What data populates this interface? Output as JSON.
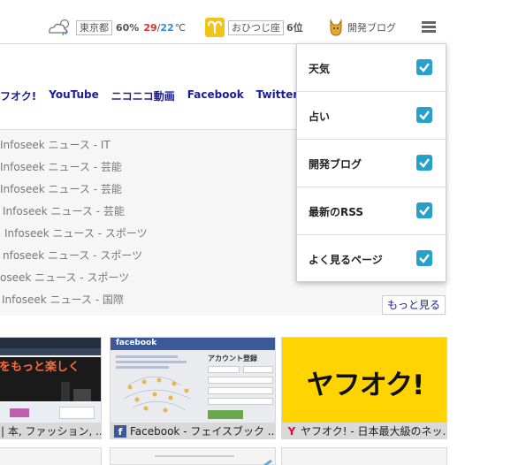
{
  "topbar": {
    "weather": {
      "city": "東京都",
      "humidity": "60%",
      "high": "29",
      "separator": "/",
      "low": "22",
      "unit": "℃",
      "icon": "cloud-rain-icon"
    },
    "fortune": {
      "sign": "おひつじ座",
      "rank": "6位",
      "icon": "aries-icon"
    },
    "blog": {
      "label": "開発ブログ",
      "icon": "mascot-icon"
    },
    "menu_icon": "menu-icon"
  },
  "links": [
    "ヤフオク!",
    "YouTube",
    "ニコニコ動画",
    "Facebook",
    "Twitter"
  ],
  "news": [
    "Infoseek ニュース - IT",
    "Infoseek ニュース - 芸能",
    "Infoseek ニュース - 芸能",
    "Infoseek ニュース - 芸能",
    "Infoseek ニュース - スポーツ",
    "nfoseek ニュース - スポーツ",
    "oseek ニュース - スポーツ",
    "Infoseek ニュース - 国際"
  ],
  "more_label": "もっと見る",
  "dropdown": [
    {
      "label": "天気",
      "checked": true
    },
    {
      "label": "占い",
      "checked": true
    },
    {
      "label": "開発ブログ",
      "checked": true
    },
    {
      "label": "最新のRSS",
      "checked": true
    },
    {
      "label": "よく見るページ",
      "checked": true
    }
  ],
  "thumbnails": [
    {
      "caption": "| 本, ファッション, ...",
      "banner_text": "をもっと楽しく"
    },
    {
      "caption": "Facebook - フェイスブック ...",
      "header": "facebook",
      "form_title": "アカウント登録"
    },
    {
      "caption": "ヤフオク! - 日本最大級のネッ...",
      "logo": "ヤフオク!"
    }
  ],
  "colors": {
    "accent": "#26a1c9",
    "link": "#1c1c9c",
    "temp_high": "#e0302e",
    "temp_low": "#2f8fd6",
    "yahoo_yellow": "#ffd400",
    "facebook_blue": "#3b5998"
  }
}
